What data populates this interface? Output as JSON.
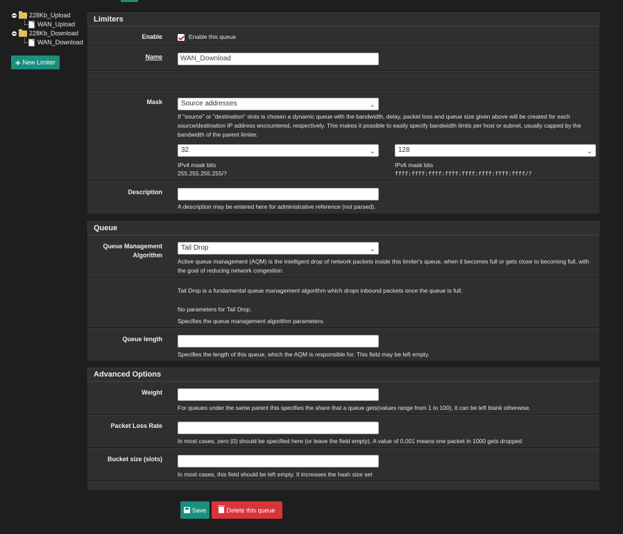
{
  "tree": {
    "nodes": [
      {
        "label": "228Kb_Upload",
        "level": 1
      },
      {
        "label": "WAN_Upload",
        "level": 2
      },
      {
        "label": "228Kb_Download",
        "level": 1
      },
      {
        "label": "WAN_Download",
        "level": 2
      }
    ],
    "new_limiter": "New Limiter"
  },
  "limiters": {
    "title": "Limiters",
    "enable_label": "Enable",
    "enable_text": "Enable this queue",
    "enable_checked": true,
    "name_label": "Name",
    "name_value": "WAN_Download",
    "mask_label": "Mask",
    "mask_value": "Source addresses",
    "mask_help": "If \"source\" or \"destination\" slots is chosen a dynamic queue with the bandwidth, delay, packet loss and queue size given above will be created for each source/destination IP address encountered, respectively. This makes it possible to easily specify bandwidth limits per host or subnet, usually capped by the bandwidth of the parent limiter.",
    "ipv4_value": "32",
    "ipv4_label": "IPv4 mask bits",
    "ipv4_sub": "255.255.255.255/?",
    "ipv6_value": "128",
    "ipv6_label": "IPv6 mask bits",
    "ipv6_sub": "ffff:ffff:ffff:ffff:ffff:ffff:ffff:ffff/?",
    "desc_label": "Description",
    "desc_value": "",
    "desc_help": "A description may be entered here for administrative reference (not parsed)."
  },
  "queue": {
    "title": "Queue",
    "qma_label_1": "Queue Management",
    "qma_label_2": "Algorithm",
    "qma_value": "Tail Drop",
    "qma_help": "Active queue management (AQM) is the intelligent drop of network packets inside this limiter's queue, when it becomes full or gets close to becoming full, with the goal of reducing network congestion.",
    "info_1": "Tail Drop is a fundamental queue management algorithm which drops inbound packets once the queue is full.",
    "info_2": "No parameters for Tail Drop.",
    "info_3": "Specifies the queue management algorithm parameters.",
    "qlen_label": "Queue length",
    "qlen_value": "",
    "qlen_help": "Specifies the length of this queue, which the AQM is responsible for. This field may be left empty."
  },
  "advanced": {
    "title": "Advanced Options",
    "weight_label": "Weight",
    "weight_help": "For queues under the same parent this specifies the share that a queue gets(values range from 1 to 100), it can be left blank otherwise.",
    "plr_label": "Packet Loss Rate",
    "plr_help": "In most cases, zero (0) should be specified here (or leave the field empty). A value of 0.001 means one packet in 1000 gets dropped",
    "bucket_label": "Bucket size (slots)",
    "bucket_help": "In most cases, this field should be left empty. It increases the hash size set"
  },
  "actions": {
    "save": "Save",
    "delete": "Delete this queue"
  },
  "colors": {
    "accent": "#1a8f7d",
    "danger": "#d9343a",
    "panel": "#2f2f2f",
    "background": "#1e1e1e"
  }
}
